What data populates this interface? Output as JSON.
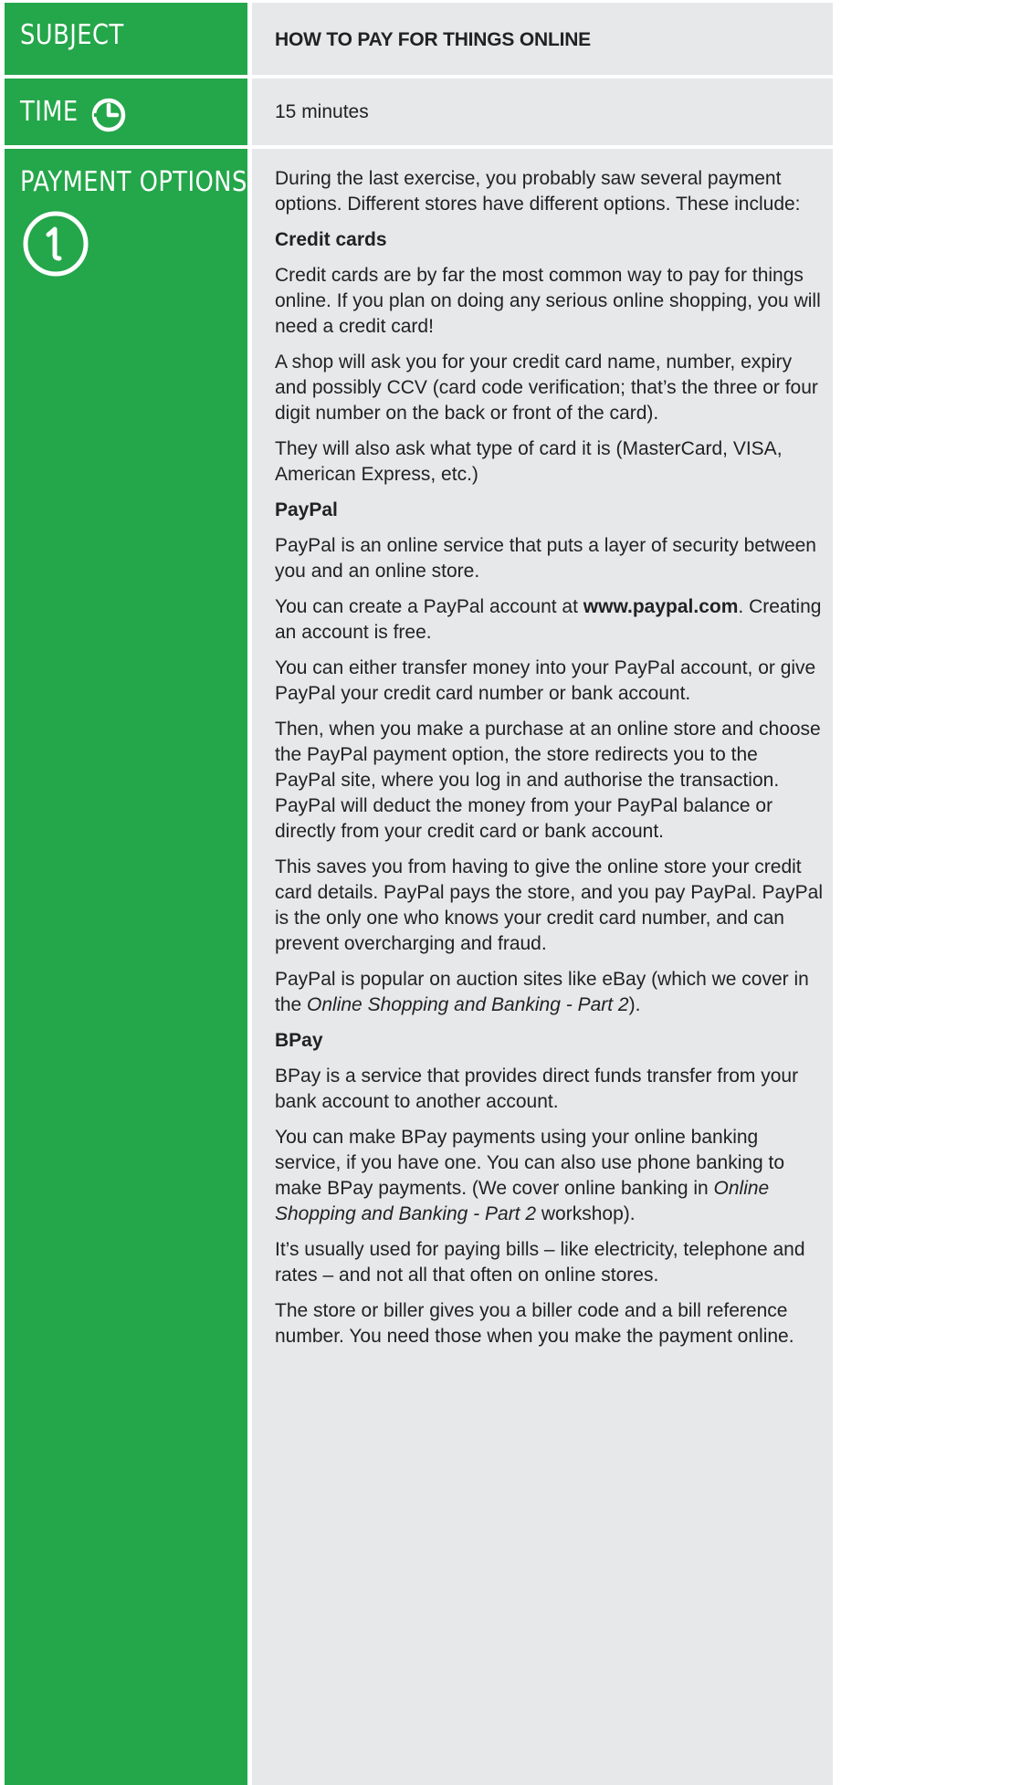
{
  "subject": {
    "label": "SUBJECT",
    "value": "HOW TO PAY FOR THINGS ONLINE"
  },
  "time": {
    "label": "TIME",
    "icon": "clock-icon",
    "value": "15 minutes"
  },
  "payment_options": {
    "label": "PAYMENT OPTIONS",
    "icon": "number-one-circle-icon",
    "intro": "During the last exercise, you probably saw several payment options. Different stores have different options. These include:",
    "credit_cards": {
      "heading": "Credit cards",
      "p1": "Credit cards are by far the most common way to pay for things online. If you plan on doing any serious online shopping, you will need a credit card!",
      "p2": "A shop will ask you for your credit card name, number, expiry and possibly CCV (card code verification; that’s the three or four digit number on the back or front of the card).",
      "p3": "They will also ask what type of card it is (MasterCard, VISA, American Express, etc.)"
    },
    "paypal": {
      "heading": "PayPal",
      "p1": "PayPal is an online service that puts a layer of security between you and an online store.",
      "p2_before": "You can create a PayPal account at ",
      "p2_link": "www.paypal.com",
      "p2_after": ". Creating an account is free.",
      "p3": "You can either transfer money into your PayPal account, or give PayPal your credit card number or bank account.",
      "p4": "Then, when you make a purchase at an online store and choose the PayPal payment option, the store redirects you to the PayPal site, where you log in and authorise the transaction. PayPal will deduct the money from your PayPal balance or directly from your credit card or bank account.",
      "p5": "This saves you from having to give the online store your credit card details. PayPal pays the store, and you pay PayPal. PayPal is the only one who knows your credit card number, and can prevent overcharging and fraud.",
      "p6_before": "PayPal is popular on auction sites like eBay (which we cover in the ",
      "p6_italic": "Online Shopping and Banking - Part 2",
      "p6_after": ")."
    },
    "bpay": {
      "heading": "BPay",
      "p1": "BPay is a service that provides direct funds transfer from your bank account to another account.",
      "p2_before": "You can make BPay payments using your online banking service, if you have one. You can also use phone banking to make BPay payments. (We cover online banking in ",
      "p2_italic": "Online Shopping and Banking - Part 2",
      "p2_after": " workshop).",
      "p3": "It’s usually used for paying bills – like electricity, telephone and rates – and not all that often on online stores.",
      "p4": "The store or biller gives you a biller code and a bill reference number. You need those when you make the payment online."
    }
  },
  "colors": {
    "label_background": "#24a64a",
    "content_background": "#e7e8ea",
    "label_text": "#ffffff",
    "body_text": "#222222"
  }
}
